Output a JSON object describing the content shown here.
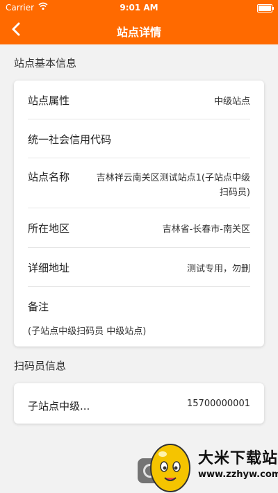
{
  "status_bar": {
    "carrier": "Carrier",
    "time": "9:01 AM"
  },
  "nav": {
    "title": "站点详情"
  },
  "basic_info": {
    "section_title": "站点基本信息",
    "rows": [
      {
        "label": "站点属性",
        "value": "中级站点"
      },
      {
        "label": "统一社会信用代码",
        "value": ""
      },
      {
        "label": "站点名称",
        "value_line1": "吉林祥云南关区测试站点1(子站点中级",
        "value_line2": "扫码员)"
      },
      {
        "label": "所在地区",
        "value": "吉林省-长春市-南关区"
      },
      {
        "label": "详细地址",
        "value": "测试专用，勿删"
      },
      {
        "label": "备注",
        "note": "(子站点中级扫码员 中级站点)"
      }
    ]
  },
  "scanner_info": {
    "section_title": "扫码员信息",
    "name": "子站点中级...",
    "phone": "15700000001"
  },
  "watermark": {
    "title": "大米下载站",
    "url": "www.zzhyw.com"
  },
  "colors": {
    "brand": "#ff6a00",
    "background": "#f2f2f2"
  }
}
